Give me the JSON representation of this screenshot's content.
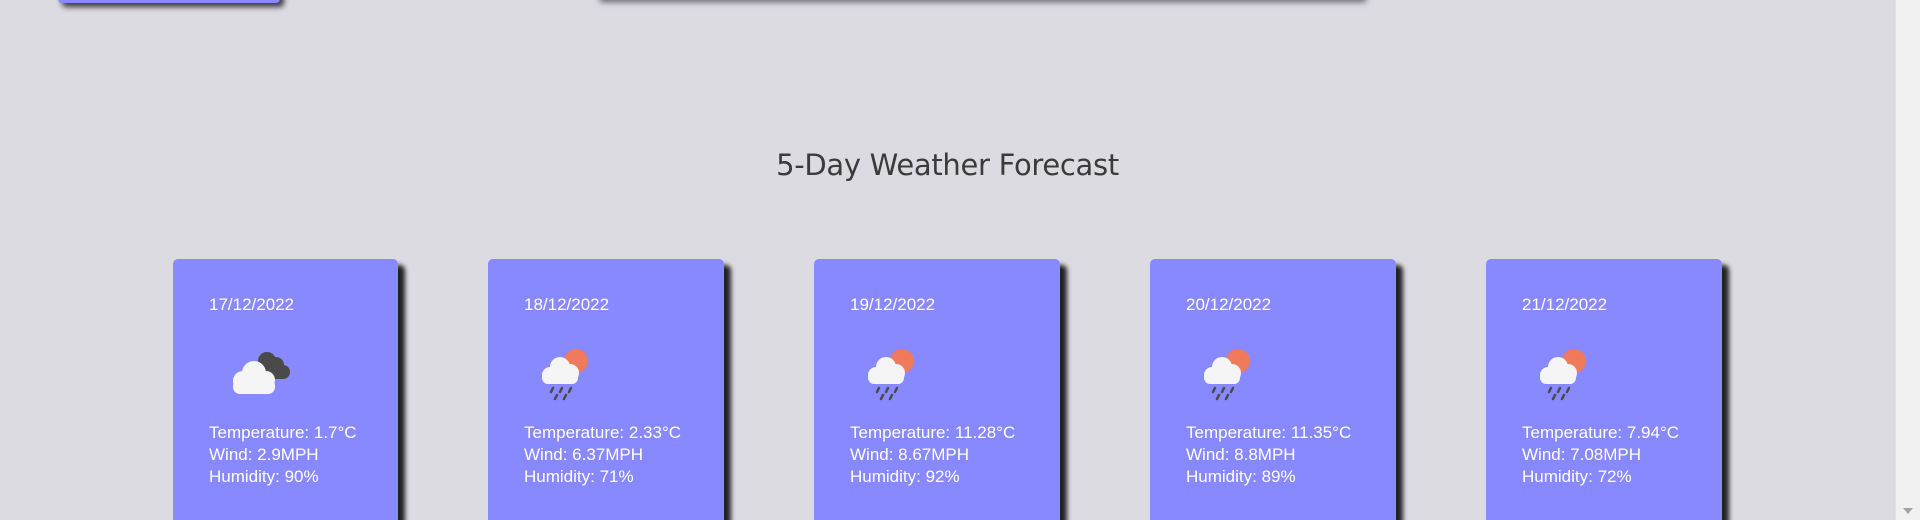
{
  "forecast": {
    "title": "5-Day Weather Forecast",
    "days": [
      {
        "date": "17/12/2022",
        "icon": "cloudy-icon",
        "temperature": "Temperature: 1.7°C",
        "wind": "Wind: 2.9MPH",
        "humidity": "Humidity: 90%"
      },
      {
        "date": "18/12/2022",
        "icon": "rain-sun-icon",
        "temperature": "Temperature: 2.33°C",
        "wind": "Wind: 6.37MPH",
        "humidity": "Humidity: 71%"
      },
      {
        "date": "19/12/2022",
        "icon": "rain-sun-icon",
        "temperature": "Temperature: 11.28°C",
        "wind": "Wind: 8.67MPH",
        "humidity": "Humidity: 92%"
      },
      {
        "date": "20/12/2022",
        "icon": "rain-sun-icon",
        "temperature": "Temperature: 11.35°C",
        "wind": "Wind: 8.8MPH",
        "humidity": "Humidity: 89%"
      },
      {
        "date": "21/12/2022",
        "icon": "rain-sun-icon",
        "temperature": "Temperature: 7.94°C",
        "wind": "Wind: 7.08MPH",
        "humidity": "Humidity: 72%"
      }
    ]
  },
  "colors": {
    "card": "#8888ff",
    "background": "#dcdbe2",
    "title": "#3b3b3b",
    "sun": "#ef7a5c"
  }
}
